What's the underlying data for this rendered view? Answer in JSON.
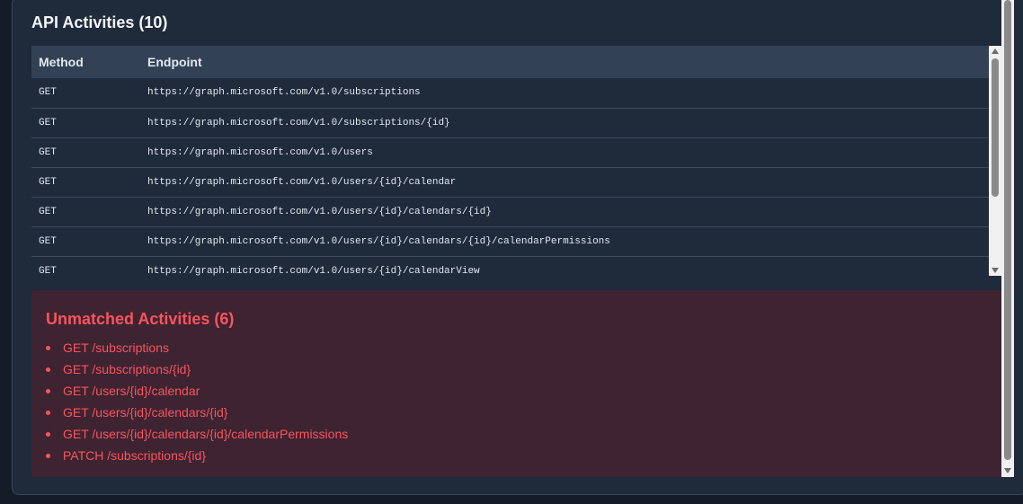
{
  "api_section": {
    "title": "API Activities (10)",
    "columns": [
      "Method",
      "Endpoint"
    ],
    "rows": [
      {
        "method": "GET",
        "endpoint": "https://graph.microsoft.com/v1.0/subscriptions"
      },
      {
        "method": "GET",
        "endpoint": "https://graph.microsoft.com/v1.0/subscriptions/{id}"
      },
      {
        "method": "GET",
        "endpoint": "https://graph.microsoft.com/v1.0/users"
      },
      {
        "method": "GET",
        "endpoint": "https://graph.microsoft.com/v1.0/users/{id}/calendar"
      },
      {
        "method": "GET",
        "endpoint": "https://graph.microsoft.com/v1.0/users/{id}/calendars/{id}"
      },
      {
        "method": "GET",
        "endpoint": "https://graph.microsoft.com/v1.0/users/{id}/calendars/{id}/calendarPermissions"
      },
      {
        "method": "GET",
        "endpoint": "https://graph.microsoft.com/v1.0/users/{id}/calendarView"
      }
    ]
  },
  "unmatched_section": {
    "title": "Unmatched Activities (6)",
    "items": [
      "GET /subscriptions",
      "GET /subscriptions/{id}",
      "GET /users/{id}/calendar",
      "GET /users/{id}/calendars/{id}",
      "GET /users/{id}/calendars/{id}/calendarPermissions",
      "PATCH /subscriptions/{id}"
    ]
  },
  "colors": {
    "panel_bg": "#1f2a3b",
    "header_bg": "#334155",
    "unmatched_bg": "#3e2331",
    "unmatched_text": "#f8545e"
  }
}
